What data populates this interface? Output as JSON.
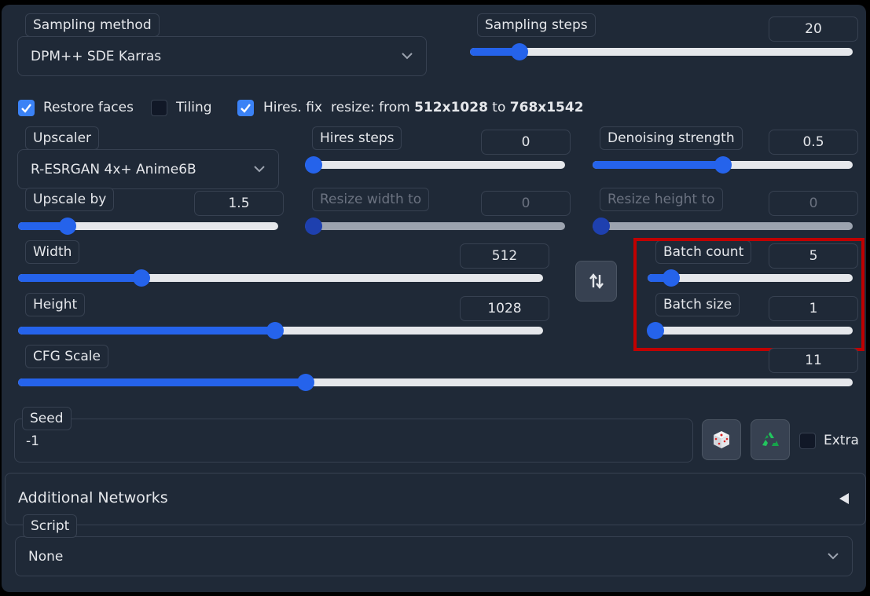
{
  "sampling": {
    "method_label": "Sampling method",
    "method_value": "DPM++ SDE Karras",
    "steps_label": "Sampling steps",
    "steps_value": "20",
    "steps_fraction": 0.13
  },
  "checks": {
    "restore_faces": "Restore faces",
    "tiling": "Tiling",
    "hires_fix": "Hires. fix",
    "resize_prefix": "resize: from ",
    "resize_from": "512x1028",
    "resize_mid": " to ",
    "resize_to": "768x1542"
  },
  "hires": {
    "upscaler_label": "Upscaler",
    "upscaler_value": "R-ESRGAN 4x+ Anime6B",
    "steps_label": "Hires steps",
    "steps_value": "0",
    "steps_fraction": 0.0,
    "denoise_label": "Denoising strength",
    "denoise_value": "0.5",
    "denoise_fraction": 0.5,
    "upscale_by_label": "Upscale by",
    "upscale_by_value": "1.5",
    "upscale_by_fraction": 0.19,
    "resize_w_label": "Resize width to",
    "resize_w_value": "0",
    "resize_h_label": "Resize height to",
    "resize_h_value": "0"
  },
  "size": {
    "width_label": "Width",
    "width_value": "512",
    "width_fraction": 0.235,
    "height_label": "Height",
    "height_value": "1028",
    "height_fraction": 0.49
  },
  "batch": {
    "count_label": "Batch count",
    "count_value": "5",
    "count_fraction": 0.08,
    "size_label": "Batch size",
    "size_value": "1",
    "size_fraction": 0.0
  },
  "cfg": {
    "label": "CFG Scale",
    "value": "11",
    "fraction": 0.345
  },
  "seed": {
    "label": "Seed",
    "value": "-1",
    "extra_label": "Extra"
  },
  "networks": {
    "title": "Additional Networks"
  },
  "script": {
    "label": "Script",
    "value": "None"
  },
  "colors": {
    "accent": "#2563eb",
    "panel": "#1f2937",
    "highlight": "#c00000"
  }
}
